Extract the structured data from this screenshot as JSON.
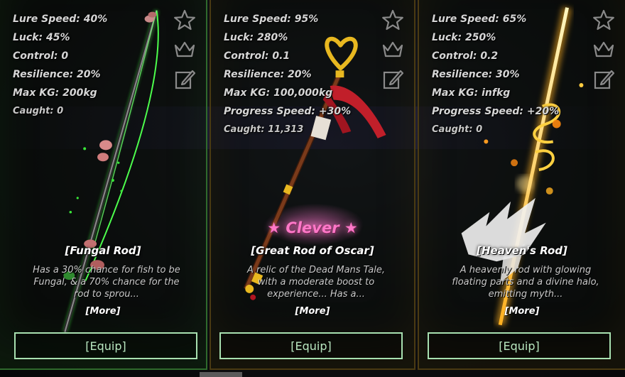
{
  "colors": {
    "equip_border": "#a8e0b0",
    "equip_text": "#b8e6bf",
    "mutation_pink": "#ff78c8",
    "card1_border": "#2f6a2c",
    "card_gold_border": "#4a3a12"
  },
  "icons": [
    "star-icon",
    "crown-icon",
    "edit-icon"
  ],
  "rods": [
    {
      "stats": [
        {
          "label": "Lure Speed: 40%"
        },
        {
          "label": "Luck: 45%"
        },
        {
          "label": "Control: 0"
        },
        {
          "label": "Resilience: 20%"
        },
        {
          "label": "Max KG: 200kg"
        }
      ],
      "caught": "Caught: 0",
      "name": "[Fungal Rod]",
      "description": "Has a 30% chance for fish to be Fungal, & a 70% chance for the rod to sprou...",
      "more": "[More]",
      "equip": "[Equip]"
    },
    {
      "stats": [
        {
          "label": "Lure Speed: 95%"
        },
        {
          "label": "Luck: 280%"
        },
        {
          "label": "Control: 0.1"
        },
        {
          "label": "Resilience: 20%"
        },
        {
          "label": "Max KG: 100,000kg"
        },
        {
          "label": "Progress Speed: +30%"
        }
      ],
      "caught": "Caught: 11,313",
      "mutation": "★ Clever ★",
      "name": "[Great Rod of Oscar]",
      "description": "A relic of the Dead Mans Tale, with a moderate boost to experience... Has a...",
      "more": "[More]",
      "equip": "[Equip]"
    },
    {
      "stats": [
        {
          "label": "Lure Speed: 65%"
        },
        {
          "label": "Luck: 250%"
        },
        {
          "label": "Control: 0.2"
        },
        {
          "label": "Resilience: 30%"
        },
        {
          "label": "Max KG: infkg"
        },
        {
          "label": "Progress Speed: +20%"
        }
      ],
      "caught": "Caught: 0",
      "name": "[Heaven's Rod]",
      "description": "A heavenly rod with glowing floating parts and a divine halo, emitting myth...",
      "more": "[More]",
      "equip": "[Equip]"
    }
  ]
}
